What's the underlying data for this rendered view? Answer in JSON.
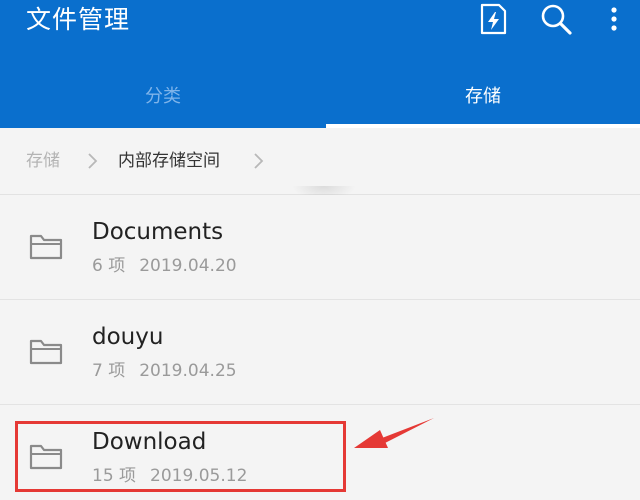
{
  "app": {
    "title": "文件管理"
  },
  "toolbar": {
    "icons": [
      "clean-storage-icon",
      "search-icon",
      "more-vert-icon"
    ]
  },
  "tabs": [
    {
      "label": "分类",
      "active": false
    },
    {
      "label": "存储",
      "active": true
    }
  ],
  "breadcrumb": [
    "存储",
    "内部存储空间"
  ],
  "files": [
    {
      "name": "Documents",
      "count": "6 项",
      "date": "2019.04.20"
    },
    {
      "name": "douyu",
      "count": "7 项",
      "date": "2019.04.25"
    },
    {
      "name": "Download",
      "count": "15 项",
      "date": "2019.05.12"
    }
  ],
  "colors": {
    "header": "#0a6fcd",
    "highlight": "#e53935",
    "background": "#f4f4f4"
  }
}
